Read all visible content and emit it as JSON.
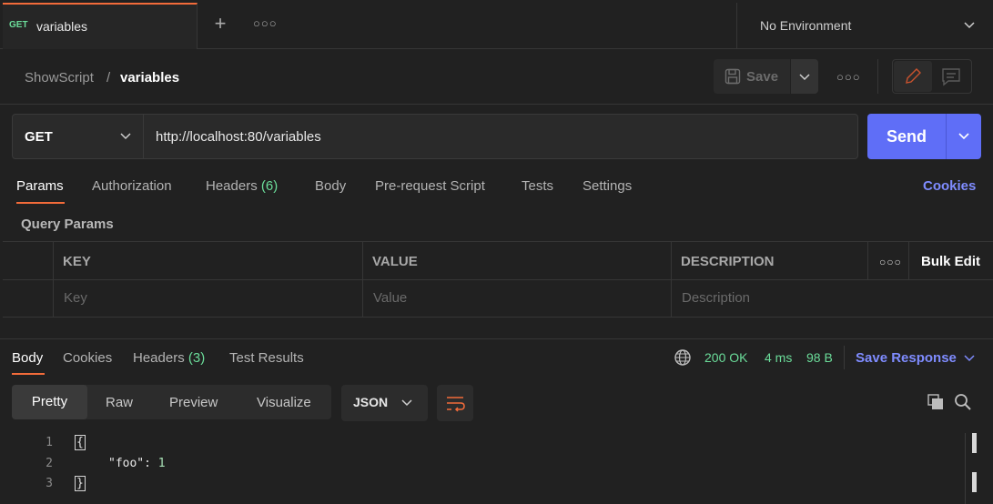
{
  "tab": {
    "method": "GET",
    "name": "variables"
  },
  "environment": {
    "label": "No Environment"
  },
  "breadcrumb": {
    "parent": "ShowScript",
    "separator": "/",
    "current": "variables"
  },
  "toolbar": {
    "save_label": "Save"
  },
  "request": {
    "method": "GET",
    "url": "http://localhost:80/variables",
    "send_label": "Send"
  },
  "request_tabs": {
    "params": "Params",
    "authorization": "Authorization",
    "headers": "Headers",
    "headers_count": "(6)",
    "body": "Body",
    "prerequest": "Pre-request Script",
    "tests": "Tests",
    "settings": "Settings",
    "cookies": "Cookies"
  },
  "query_params": {
    "title": "Query Params",
    "columns": {
      "key": "KEY",
      "value": "VALUE",
      "description": "DESCRIPTION"
    },
    "bulk_edit": "Bulk Edit",
    "placeholders": {
      "key": "Key",
      "value": "Value",
      "description": "Description"
    }
  },
  "response_tabs": {
    "body": "Body",
    "cookies": "Cookies",
    "headers": "Headers",
    "headers_count": "(3)",
    "test_results": "Test Results"
  },
  "response_status": {
    "status": "200 OK",
    "time": "4 ms",
    "size": "98 B",
    "save_response": "Save Response"
  },
  "view_modes": {
    "pretty": "Pretty",
    "raw": "Raw",
    "preview": "Preview",
    "visualize": "Visualize"
  },
  "format": {
    "selected": "JSON"
  },
  "code": {
    "line_numbers": [
      "1",
      "2",
      "3"
    ],
    "open_brace": "{",
    "key": "\"foo\"",
    "colon": ":",
    "value": "1",
    "close_brace": "}"
  },
  "colors": {
    "accent": "#f26b3a",
    "send": "#5f6ef7",
    "link": "#7f8cff",
    "success": "#6bdd9a",
    "background": "#212121"
  }
}
